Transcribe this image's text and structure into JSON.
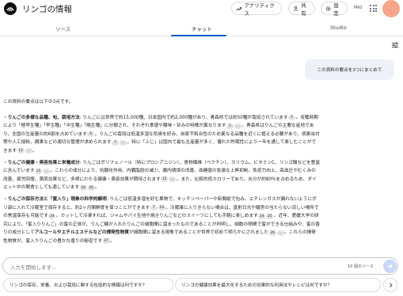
{
  "header": {
    "title": "リンゴの情報",
    "analytics_label": "アナリティクス",
    "share_label": "共有",
    "settings_label": "設定",
    "pro_label": "PRO"
  },
  "tabs": {
    "sources": "ソース",
    "chat": "チャット",
    "studio": "Studio"
  },
  "chat": {
    "user_message": "この資料の要点を3つにまとめて",
    "answer": {
      "intro": "この資料の要点は以下の3点です。",
      "p1": {
        "title": "りんごの多様な品種、旬、栽培方法",
        "t1": ": りんごには世界で約15,000種、日本国内で約2,000種があり、青森県では約50種が栽培されています",
        "c1": "1",
        "t2": "。収穫時期により「極早生種」「早生種」「中生種」「晩生種」に分類され、それぞれ食感や酸味・甘みの特徴が異なります",
        "c2": "1",
        "c3": "…",
        "t3": "。青森県はりんごの主要な産地であり、全国の生産量の約6割を占めています",
        "c4": "6",
        "t4": "。りんごの栽培は低温多湿な気候を好み、自家不和合性のため異なる品種を近くに植える必要があり、病害虫対策や人工授粉、摘果などの適切な管理が求められます",
        "c5": "7",
        "c6": "…",
        "t5": "。特に「ふじ」は国内で最も生産量が多く、優れた貯蔵性により一年を通して楽しむことができます",
        "c7": "12",
        "c8": "…",
        "t6": "。"
      },
      "p2": {
        "title": "りんごの健康・美容効果と栄養成分",
        "t1": ": りんごはポリフェノール（特にプロシアニジン）、食物繊維（ペクチン）、カリウム、ビタミンC、リンゴ酸などを豊富に含んでいます",
        "c1": "15",
        "c2": "…",
        "t2": "。これらの成分により、抗酸化作用、内臓脂肪の減少、腸内環境の改善、血糖値の急激な上昇抑制、免疫力向上、高血圧やむくみの改善、疲労回復、美肌効果など、多様にわたる健康・美容効果が期待されます",
        "c3": "15",
        "c4": "…",
        "t3": "。また、比較的低カロリーであり、水分が約80%を占めるため、ダイエット中の間食としても適しています",
        "c5": "18",
        "c6": "20",
        "t4": "。"
      },
      "p3": {
        "title": "りんごの保存方法と「蜜入り」現象の科学的解明",
        "t1": ": りんごは低温多湿を好む果物で、キッチンペーパーや新聞紙で包み、エチレンガスが漏れないようにポリ袋に入れて冷蔵室で保存すると、約2ヶ月間鮮度を保つことができます",
        "c1": "7",
        "c2": "24",
        "t2": "。冷蔵庫に入りきらない場合は、直射日光や暖房の当たらない涼しい場所での常温保存も可能です",
        "c3": "24",
        "t3": "。カットして冷凍すれば、ジャムやパイ生地や焼きりんごなどのスイーツにしても手軽に楽しめます",
        "c4": "24",
        "c5": "25",
        "t4": "。近年、愛媛大学の研究により、「蜜入りりんご」の蜜の正体が、りんご糖が入れたりんごの細胞間に溜まったものであることが判明し、細胞の隙間で蜜ができる仕組みや、蜜の香りの成分としてアルコールやエチルエステルなどの揮発性物質",
        "bold": "アルコールやエチルエステルなどの揮発性物質",
        "t5": "が細胞間に溜まる現象であることが世界で初めて明らかにされました",
        "c6": "26",
        "c7": "…",
        "t6": "。これらの揮発性物質が、蜜入りりんごの豊かな香りの秘密です",
        "c8": "27",
        "t7": "。"
      }
    }
  },
  "input": {
    "placeholder": "入力を開始します...",
    "source_count": "10 個のソース"
  },
  "suggestions": [
    "リンゴの保存、栄養、および栽培に関する包括的な情報は何ですか？",
    "リンゴの健康効果を最大化するための効果的な利用法やレシピは何ですか？"
  ],
  "colors": {
    "accent": "#0b57d0",
    "bubble": "#eef1f8",
    "avatar": "#f7a58a",
    "send": "#c9d7f8"
  }
}
